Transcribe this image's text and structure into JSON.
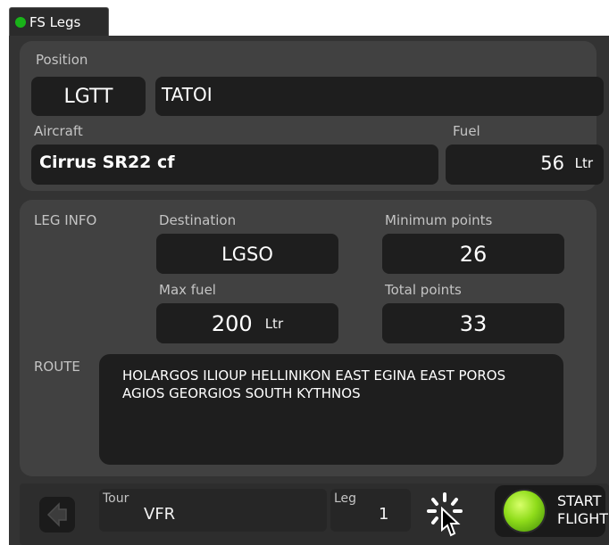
{
  "window": {
    "tab_title": "FS Legs",
    "status_color": "#19b319"
  },
  "position": {
    "label": "Position",
    "icao": "LGTT",
    "name": "TATOI"
  },
  "aircraft": {
    "label": "Aircraft",
    "name": "Cirrus SR22 cf"
  },
  "fuel": {
    "label": "Fuel",
    "value": "56",
    "unit": "Ltr"
  },
  "leg_info": {
    "label": "LEG INFO",
    "destination_label": "Destination",
    "destination": "LGSO",
    "min_points_label": "Minimum points",
    "min_points": "26",
    "max_fuel_label": "Max fuel",
    "max_fuel": "200",
    "max_fuel_unit": "Ltr",
    "total_points_label": "Total points",
    "total_points": "33",
    "route_label": "ROUTE",
    "route": "HOLARGOS ILIOUP HELLINIKON EAST EGINA EAST POROS AGIOS GEORGIOS SOUTH KYTHNOS"
  },
  "footer": {
    "tour_label": "Tour",
    "tour_value": "VFR",
    "leg_label": "Leg",
    "leg_value": "1",
    "start_line1": "START",
    "start_line2": "FLIGHT"
  },
  "icons": [
    "status-dot-icon",
    "back-arrow-icon",
    "loading-spinner-icon",
    "mouse-cursor-icon",
    "green-light-icon"
  ]
}
